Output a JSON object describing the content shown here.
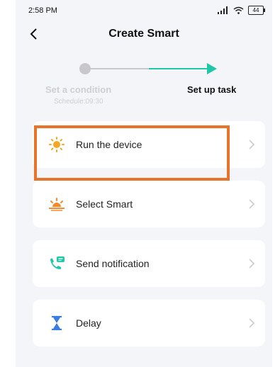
{
  "status": {
    "time": "2:58 PM",
    "battery": "44"
  },
  "header": {
    "title": "Create Smart"
  },
  "steps": [
    {
      "label": "Set a condition",
      "sub": "Schedule:09:30"
    },
    {
      "label": "Set up task"
    }
  ],
  "tasks": [
    {
      "label": "Run the device",
      "icon": "sun-icon"
    },
    {
      "label": "Select Smart",
      "icon": "sunrise-icon"
    },
    {
      "label": "Send notification",
      "icon": "phone-message-icon"
    },
    {
      "label": "Delay",
      "icon": "hourglass-icon"
    }
  ],
  "colors": {
    "accent": "#1ec7a6",
    "highlight": "#e8732a",
    "sun": "#f5a623",
    "delay": "#3b7de0"
  }
}
